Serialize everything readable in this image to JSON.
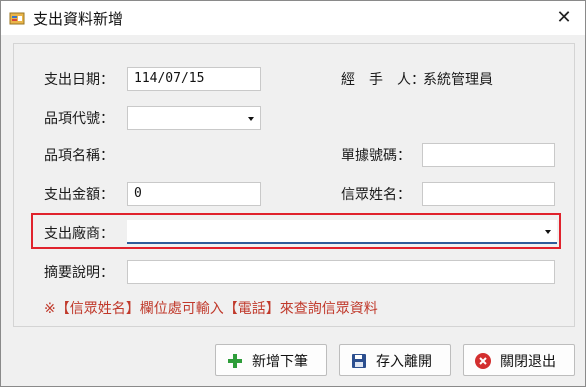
{
  "window": {
    "title": "支出資料新增",
    "close_symbol": "✕"
  },
  "form": {
    "date_label": "支出日期：",
    "date_value": "114/07/15",
    "handler_label": "經　手　人：",
    "handler_value": "系統管理員",
    "item_code_label": "品項代號：",
    "item_code_value": "",
    "item_name_label": "品項名稱：",
    "item_name_value": "",
    "receipt_label": "單據號碼：",
    "receipt_value": "",
    "amount_label": "支出金額：",
    "amount_value": "0",
    "donor_label": "信眾姓名：",
    "donor_value": "",
    "vendor_label": "支出廠商：",
    "vendor_value": "",
    "summary_label": "摘要說明：",
    "summary_value": ""
  },
  "note": "※【信眾姓名】欄位處可輸入【電話】來查詢信眾資料",
  "buttons": {
    "add_next": "新增下筆",
    "save_leave": "存入離開",
    "close_exit": "關閉退出"
  },
  "icons": {
    "app": "form-icon",
    "add": "plus-icon",
    "save": "floppy-icon",
    "close": "x-circle-icon"
  },
  "colors": {
    "highlight": "#e0222c",
    "note": "#c0392b",
    "add_icon": "#2e9d3a",
    "save_icon": "#2c4f8f",
    "close_icon": "#d32f2f"
  }
}
